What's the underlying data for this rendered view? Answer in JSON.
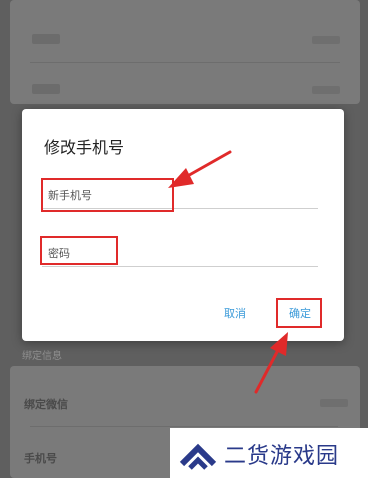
{
  "dialog": {
    "title": "修改手机号",
    "phone_placeholder": "新手机号",
    "password_placeholder": "密码",
    "cancel_label": "取消",
    "confirm_label": "确定"
  },
  "background": {
    "section_label": "绑定信息",
    "items": [
      "绑定微信",
      "手机号"
    ]
  },
  "watermark": {
    "text": "二货游戏园"
  },
  "colors": {
    "accent": "#3a9ad9",
    "highlight": "#e02a2a",
    "watermark_text": "#2a3a8a"
  }
}
